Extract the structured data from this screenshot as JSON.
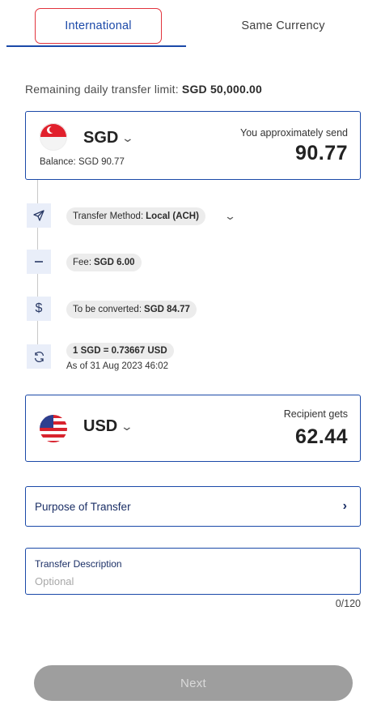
{
  "tabs": {
    "international": "International",
    "same_currency": "Same Currency"
  },
  "limit": {
    "label": "Remaining daily transfer limit:",
    "value": "SGD 50,000.00"
  },
  "send": {
    "currency": "SGD",
    "balance": "Balance: SGD 90.77",
    "label": "You approximately send",
    "amount": "90.77",
    "flag_icon": "singapore-flag-icon"
  },
  "steps": {
    "method_label": "Transfer Method:",
    "method_value": "Local (ACH)",
    "fee_label": "Fee:",
    "fee_value": "SGD 6.00",
    "converted_label": "To be converted:",
    "converted_value": "SGD 84.77",
    "rate": "1 SGD = 0.73667 USD",
    "as_of": "As of 31 Aug 2023 46:02",
    "icons": [
      "send-arrow-icon",
      "minus-icon",
      "dollar-icon",
      "refresh-icon"
    ]
  },
  "receive": {
    "currency": "USD",
    "label": "Recipient gets",
    "amount": "62.44",
    "flag_icon": "usa-flag-icon"
  },
  "purpose": {
    "label": "Purpose of Transfer"
  },
  "description": {
    "label": "Transfer Description",
    "placeholder": "Optional",
    "value": "",
    "counter": "0/120"
  },
  "next": {
    "label": "Next"
  },
  "colors": {
    "primary": "#1b49a8",
    "active_tab_border": "#e2343d",
    "disabled_button": "#9e9e9e",
    "step_icon_bg": "#e9eef9",
    "pill_bg": "#ececec"
  }
}
